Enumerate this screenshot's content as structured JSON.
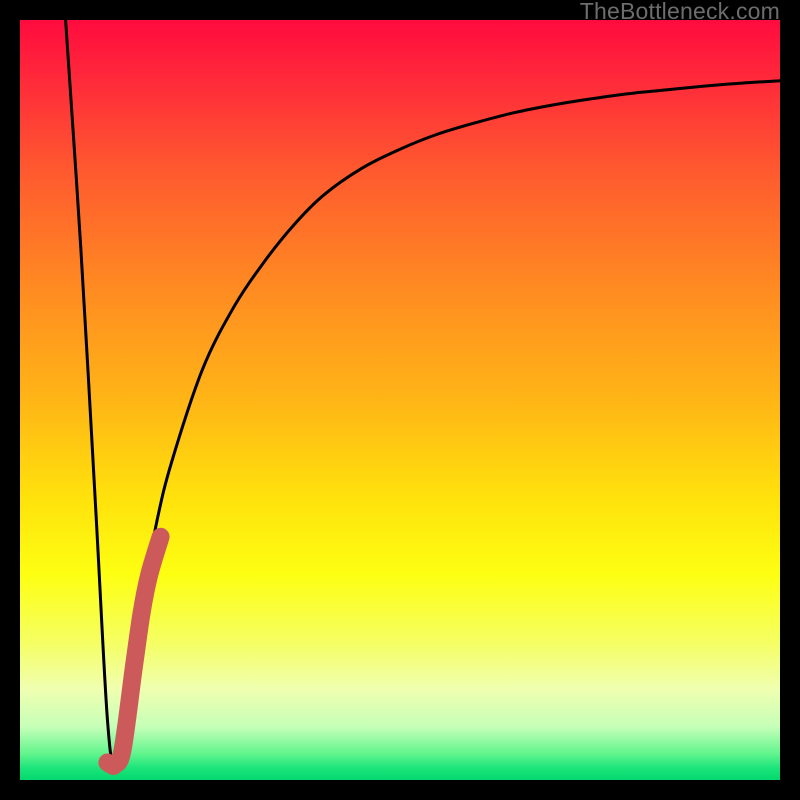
{
  "chart_data": {
    "type": "line",
    "title": "",
    "xlabel": "",
    "ylabel": "",
    "xlim": [
      0,
      100
    ],
    "ylim": [
      0,
      100
    ],
    "grid": false,
    "series": [
      {
        "name": "bottleneck-curve",
        "x": [
          6,
          8,
          10,
          11.5,
          12.5,
          14,
          16,
          18,
          20,
          24,
          28,
          32,
          36,
          40,
          45,
          50,
          55,
          60,
          65,
          70,
          75,
          80,
          85,
          90,
          95,
          100
        ],
        "y": [
          100,
          70,
          35,
          8,
          2,
          8,
          23,
          34,
          42,
          54,
          62,
          68,
          73,
          77,
          80.5,
          83,
          85,
          86.5,
          87.8,
          88.8,
          89.6,
          90.3,
          90.8,
          91.3,
          91.7,
          92
        ]
      },
      {
        "name": "highlight-segment",
        "x": [
          11.5,
          12,
          12.5,
          13.5,
          15,
          16,
          17,
          18.5
        ],
        "y": [
          2.3,
          2.0,
          2.0,
          4,
          15,
          22,
          27,
          32
        ]
      }
    ],
    "gradient_stops": [
      {
        "offset": 0.0,
        "color": "#ff0b3e"
      },
      {
        "offset": 0.08,
        "color": "#ff2a3a"
      },
      {
        "offset": 0.2,
        "color": "#ff5a2f"
      },
      {
        "offset": 0.35,
        "color": "#ff8a22"
      },
      {
        "offset": 0.5,
        "color": "#ffb516"
      },
      {
        "offset": 0.63,
        "color": "#ffe20c"
      },
      {
        "offset": 0.73,
        "color": "#fdff12"
      },
      {
        "offset": 0.82,
        "color": "#f5ff64"
      },
      {
        "offset": 0.88,
        "color": "#f0ffb0"
      },
      {
        "offset": 0.93,
        "color": "#c6ffb8"
      },
      {
        "offset": 0.965,
        "color": "#63f58e"
      },
      {
        "offset": 0.985,
        "color": "#19e47a"
      },
      {
        "offset": 1.0,
        "color": "#04d86f"
      }
    ],
    "highlight_color": "#cc5a5a",
    "curve_color": "#000000"
  },
  "watermark": "TheBottleneck.com"
}
